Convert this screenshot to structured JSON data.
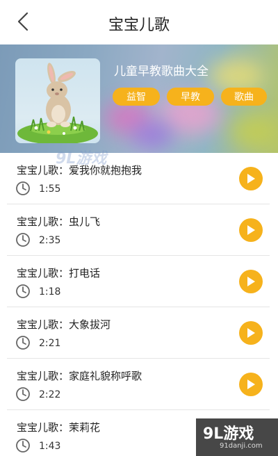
{
  "header": {
    "title": "宝宝儿歌"
  },
  "album": {
    "name": "儿童早教歌曲大全",
    "tags": [
      "益智",
      "早教",
      "歌曲"
    ]
  },
  "songs": [
    {
      "name": "宝宝儿歌：爱我你就抱抱我",
      "duration": "1:55"
    },
    {
      "name": "宝宝儿歌：虫儿飞",
      "duration": "2:35"
    },
    {
      "name": "宝宝儿歌：打电话",
      "duration": "1:18"
    },
    {
      "name": "宝宝儿歌：大象拔河",
      "duration": "2:21"
    },
    {
      "name": "宝宝儿歌：家庭礼貌称呼歌",
      "duration": "2:22"
    },
    {
      "name": "宝宝儿歌：茉莉花",
      "duration": "1:43"
    }
  ],
  "watermark": {
    "center": "9L游戏",
    "badge": "9L游戏",
    "badge_url": "91danji.com"
  },
  "colors": {
    "accent": "#f6b21c",
    "separator": "#e5e5e5",
    "text": "#222222"
  },
  "icons": {
    "back": "back-arrow-icon",
    "clock": "clock-icon",
    "play": "play-icon"
  }
}
